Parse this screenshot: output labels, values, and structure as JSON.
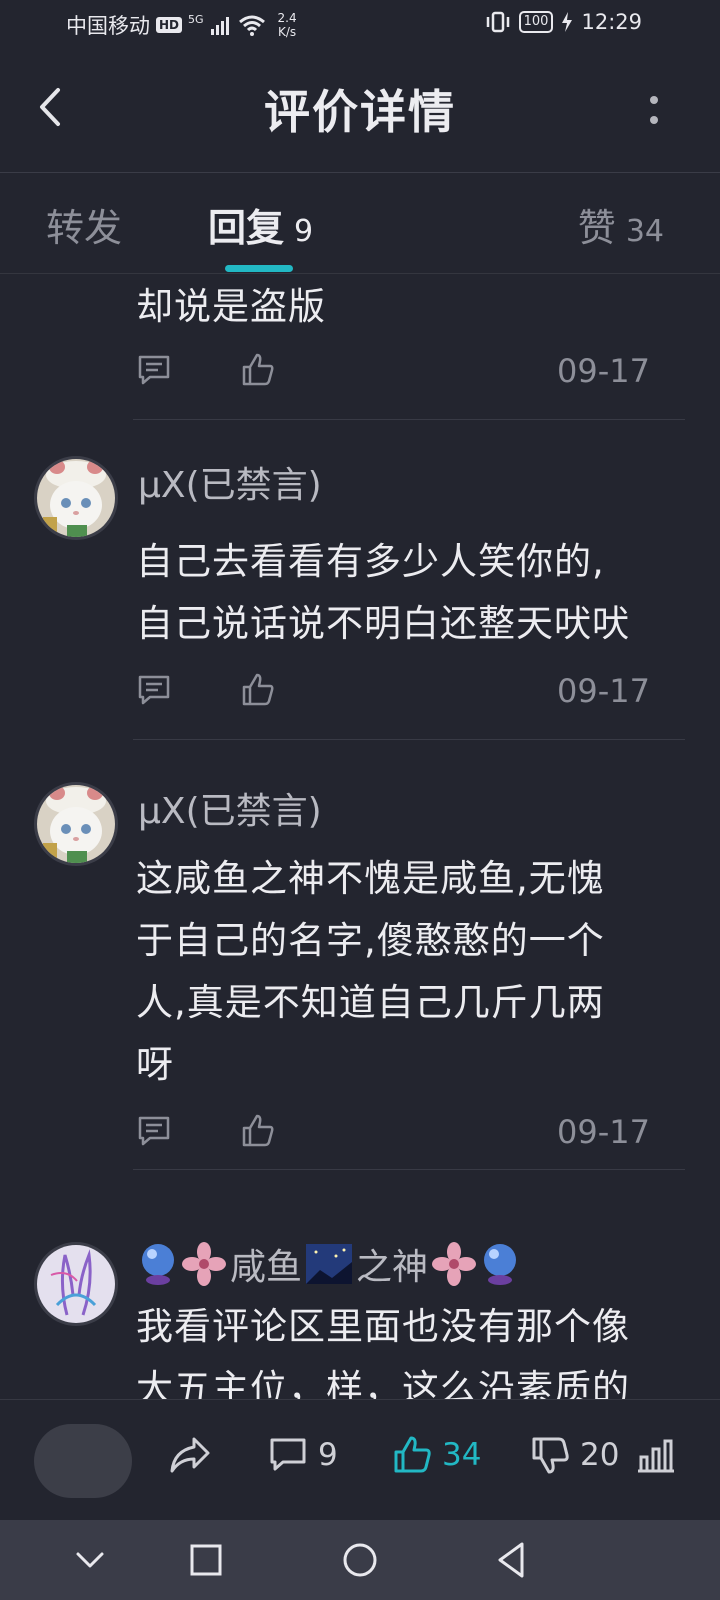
{
  "status_bar": {
    "carrier": "中国移动",
    "hd": "HD",
    "signal_tag": "5G",
    "net_speed_value": "2.4",
    "net_speed_unit": "K/s",
    "battery": "100",
    "time": "12:29"
  },
  "header": {
    "title": "评价详情"
  },
  "tabs": [
    {
      "label": "转发",
      "count": ""
    },
    {
      "label": "回复",
      "count": "9"
    },
    {
      "label": "赞",
      "count": "34"
    }
  ],
  "replies": [
    {
      "user": "",
      "content_lines": [
        "却说是盗版"
      ],
      "date": "09-17"
    },
    {
      "user": "μX(已禁言)",
      "content_lines": [
        "自己去看看有多少人笑你的,",
        "自己说话说不明白还整天吠吠"
      ],
      "date": "09-17"
    },
    {
      "user": "μX(已禁言)",
      "content_lines": [
        "这咸鱼之神不愧是咸鱼,无愧",
        "于自己的名字,傻憨憨的一个",
        "人,真是不知道自己几斤几两",
        "呀"
      ],
      "date": "09-17"
    },
    {
      "user_part1": "咸鱼",
      "user_part2": "之神",
      "content_lines": [
        "我看评论区里面也没有那个像",
        "大五主位，样，这么沿素质的"
      ]
    }
  ],
  "bottom_bar": {
    "reply_count": "9",
    "like_count": "34",
    "dislike_count": "20"
  },
  "colors": {
    "background": "#23252f",
    "accent": "#22b8c4",
    "text_primary": "#ececf0",
    "text_secondary": "#8d8f99"
  }
}
